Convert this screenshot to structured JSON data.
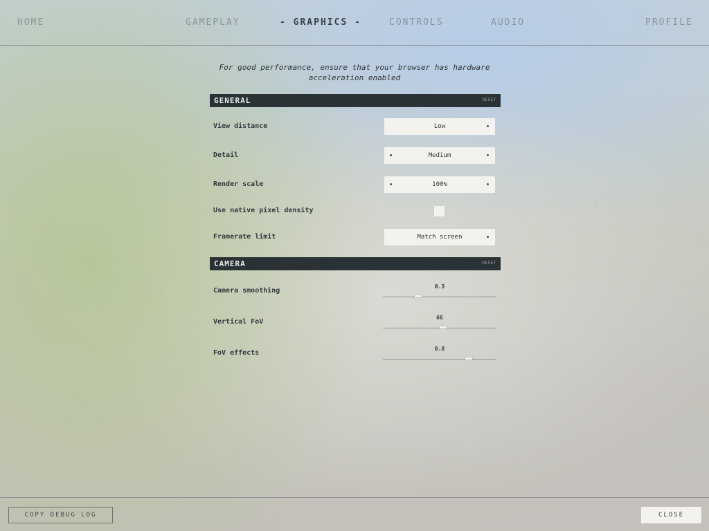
{
  "nav": {
    "home": "HOME",
    "gameplay": "GAMEPLAY",
    "graphics": "- GRAPHICS -",
    "controls": "CONTROLS",
    "audio": "AUDIO",
    "profile": "PROFILE"
  },
  "notice": "For good performance, ensure that your browser has hardware acceleration enabled",
  "general": {
    "title": "GENERAL",
    "reset_label": "RESET",
    "view_distance": {
      "label": "View distance",
      "value": "Low"
    },
    "detail": {
      "label": "Detail",
      "value": "Medium"
    },
    "render_scale": {
      "label": "Render scale",
      "value": "100%"
    },
    "native_pixel_density": {
      "label": "Use native pixel density",
      "checked": false
    },
    "framerate_limit": {
      "label": "Framerate limit",
      "value": "Match screen"
    }
  },
  "camera": {
    "title": "CAMERA",
    "reset_label": "RESET",
    "camera_smoothing": {
      "label": "Camera smoothing",
      "value": "0.3",
      "fraction": 0.3
    },
    "vertical_fov": {
      "label": "Vertical FoV",
      "value": "66",
      "fraction": 0.53
    },
    "fov_effects": {
      "label": "FoV effects",
      "value": "0.8",
      "fraction": 0.77
    }
  },
  "footer": {
    "copy_debug_log": "COPY DEBUG LOG",
    "close": "CLOSE"
  }
}
